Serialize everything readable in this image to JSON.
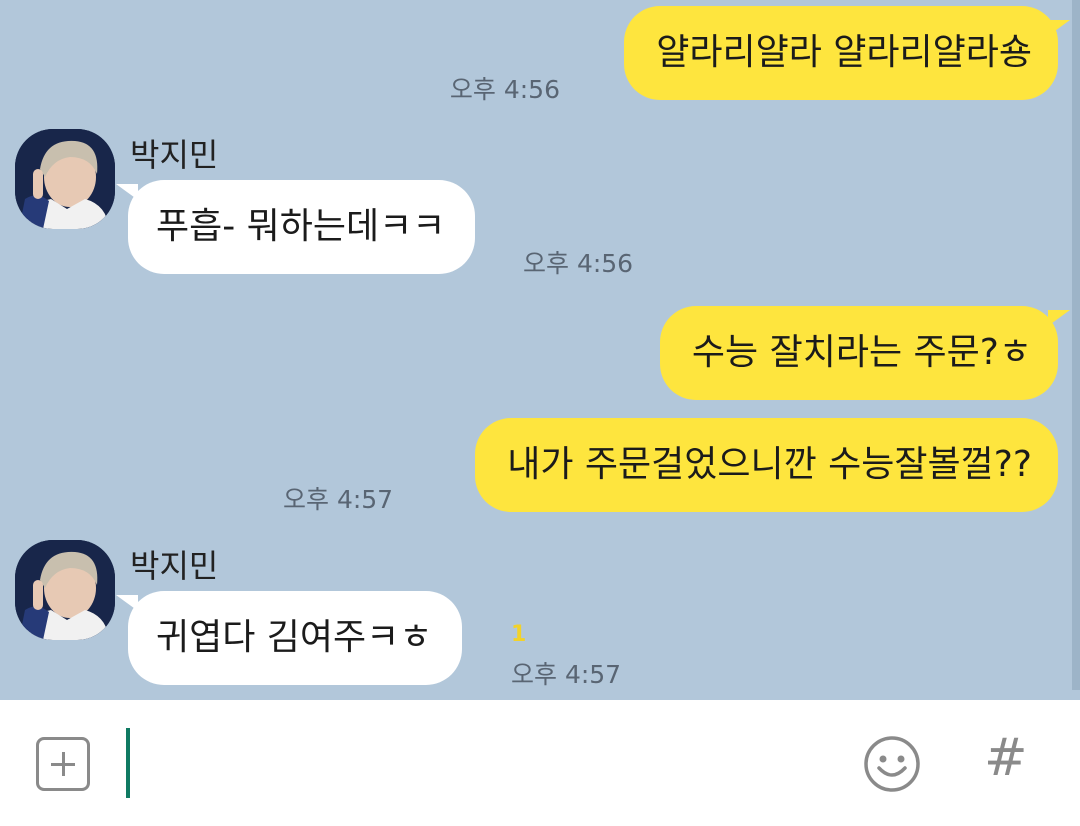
{
  "chat": {
    "messages": [
      {
        "from": "me",
        "text": "얄라리얄라 얄라리얄라숑",
        "time": "오후 4:56"
      },
      {
        "from": "other",
        "sender": "박지민",
        "text": "푸흡- 뭐하는데ㅋㅋ",
        "time": "오후 4:56"
      },
      {
        "from": "me",
        "text": "수능 잘치라는 주문?ㅎ",
        "time": ""
      },
      {
        "from": "me",
        "text": "내가 주문걸었으니깐 수능잘볼껄??",
        "time": "오후 4:57"
      },
      {
        "from": "other",
        "sender": "박지민",
        "text": "귀엽다 김여주ㅋㅎ",
        "time": "오후 4:57",
        "unread": "1"
      }
    ]
  },
  "composer": {
    "input_value": "",
    "placeholder": "",
    "attach_icon": "plus-square-icon",
    "emoji_icon": "smiley-icon",
    "hash_label": "#"
  },
  "colors": {
    "chat_background": "#b2c7da",
    "my_bubble": "#fee53e",
    "other_bubble": "#ffffff",
    "timestamp": "#596573",
    "unread": "#f2d22a",
    "cursor": "#0f7a62"
  }
}
